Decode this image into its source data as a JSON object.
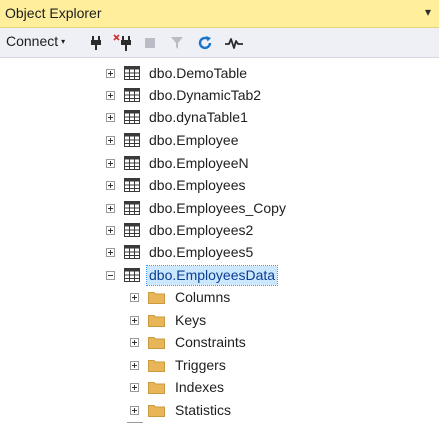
{
  "window": {
    "title": "Object Explorer",
    "pin_glyph": "▾"
  },
  "toolbar": {
    "connect_label": "Connect",
    "connect_caret": "▾",
    "icons": [
      "connect-plug-icon",
      "disconnect-plug-icon",
      "stop-icon",
      "filter-icon",
      "refresh-icon",
      "activity-monitor-icon"
    ]
  },
  "tree": {
    "tables": [
      {
        "label": "dbo.DemoTable",
        "expanded": false
      },
      {
        "label": "dbo.DynamicTab2",
        "expanded": false
      },
      {
        "label": "dbo.dynaTable1",
        "expanded": false
      },
      {
        "label": "dbo.Employee",
        "expanded": false
      },
      {
        "label": "dbo.EmployeeN",
        "expanded": false
      },
      {
        "label": "dbo.Employees",
        "expanded": false
      },
      {
        "label": "dbo.Employees_Copy",
        "expanded": false
      },
      {
        "label": "dbo.Employees2",
        "expanded": false
      },
      {
        "label": "dbo.Employees5",
        "expanded": false
      },
      {
        "label": "dbo.EmployeesData",
        "expanded": true,
        "selected": true
      }
    ],
    "children": [
      {
        "label": "Columns"
      },
      {
        "label": "Keys"
      },
      {
        "label": "Constraints"
      },
      {
        "label": "Triggers"
      },
      {
        "label": "Indexes"
      },
      {
        "label": "Statistics"
      }
    ]
  },
  "colors": {
    "title_bar": "#ffef9c",
    "toolbar": "#eef0f6",
    "selection": "#cce8ff",
    "folder": "#e8b659",
    "refresh": "#1b74c9"
  }
}
